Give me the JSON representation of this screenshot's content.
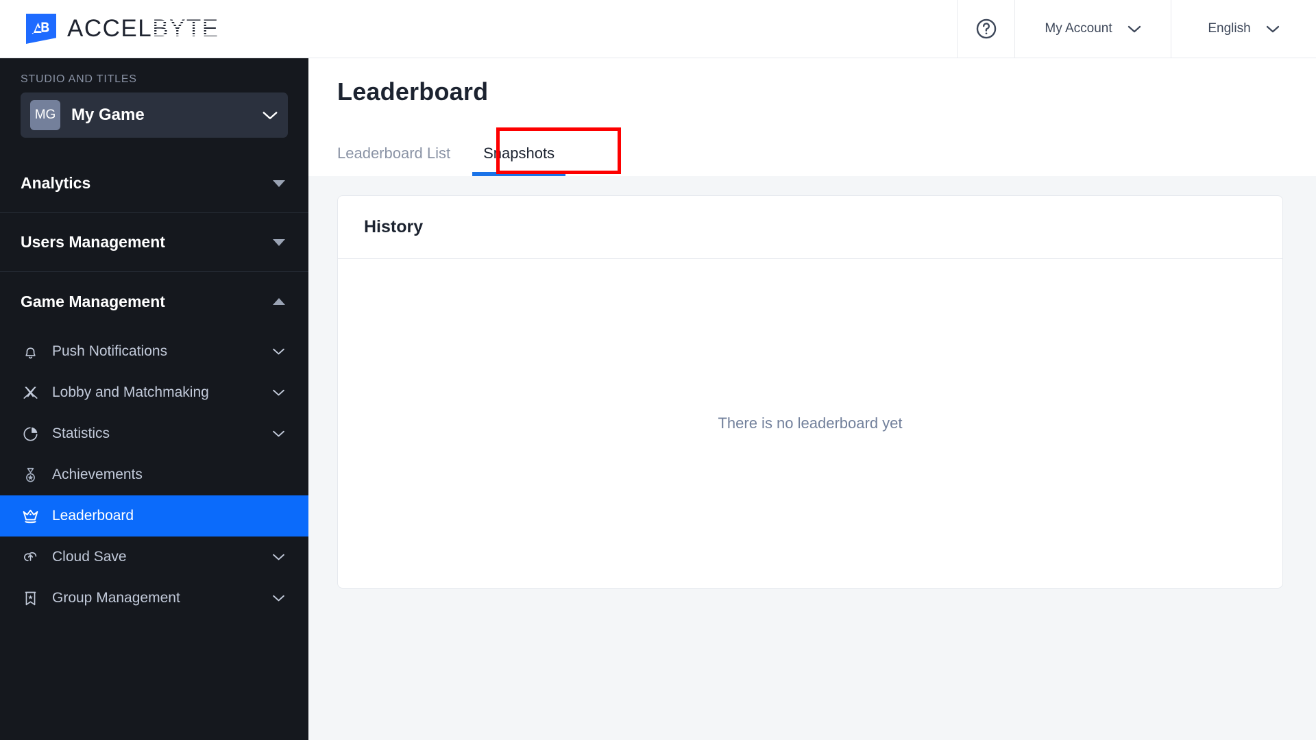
{
  "header": {
    "brand_part1": "ACCEL",
    "brand_part2": "BYTE",
    "brand_mark_text": "AB",
    "help_icon": "help-circle-icon",
    "account_label": "My Account",
    "language_label": "English"
  },
  "sidebar": {
    "studio_label": "STUDIO AND TITLES",
    "game": {
      "initials": "MG",
      "name": "My Game"
    },
    "sections": [
      {
        "title": "Analytics",
        "caret": "triangle-down",
        "expanded": false
      },
      {
        "title": "Users Management",
        "caret": "triangle-down",
        "expanded": false
      },
      {
        "title": "Game Management",
        "caret": "triangle-up",
        "expanded": true
      }
    ],
    "items": [
      {
        "label": "Push Notifications",
        "icon": "bell-icon",
        "chevron": true,
        "active": false
      },
      {
        "label": "Lobby and Matchmaking",
        "icon": "crossed-swords-icon",
        "chevron": true,
        "active": false
      },
      {
        "label": "Statistics",
        "icon": "pie-chart-icon",
        "chevron": true,
        "active": false
      },
      {
        "label": "Achievements",
        "icon": "medal-icon",
        "chevron": false,
        "active": false
      },
      {
        "label": "Leaderboard",
        "icon": "crown-icon",
        "chevron": false,
        "active": true
      },
      {
        "label": "Cloud Save",
        "icon": "cloud-upload-icon",
        "chevron": true,
        "active": false
      },
      {
        "label": "Group Management",
        "icon": "banner-star-icon",
        "chevron": true,
        "active": false
      }
    ]
  },
  "main": {
    "page_title": "Leaderboard",
    "tabs": [
      {
        "label": "Leaderboard List",
        "active": false
      },
      {
        "label": "Snapshots",
        "active": true
      }
    ],
    "card": {
      "title": "History",
      "empty_message": "There is no leaderboard yet"
    }
  },
  "annotation": {
    "target": "Snapshots",
    "color": "#fd0000"
  },
  "colors": {
    "accent_blue": "#0b6bfb",
    "tab_underline": "#1a73e8",
    "sidebar_bg": "#15181e",
    "page_bg": "#f4f6f8",
    "annotation_red": "#fd0000"
  }
}
